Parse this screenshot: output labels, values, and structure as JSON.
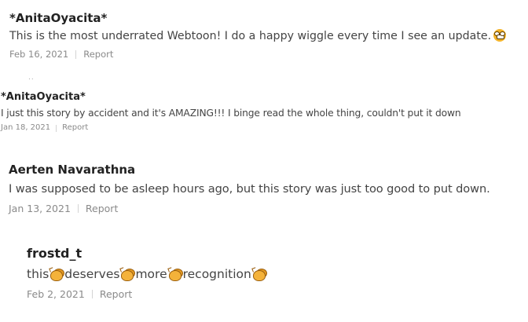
{
  "comments": [
    {
      "author": "*AnitaOyacita*",
      "text": "This is the most underrated Webtoon! I do a happy wiggle every time I see an update.",
      "emoji": "grimacing-face-icon",
      "date": "Feb 16, 2021",
      "report_label": "Report"
    },
    {
      "author": "*AnitaOyacita*",
      "text": "I just this story by accident and it's AMAZING!!! I binge read the whole thing, couldn't put it down",
      "date": "Jan 18, 2021",
      "report_label": "Report"
    },
    {
      "author": "Aerten Navarathna",
      "text": "I was supposed to be asleep hours ago, but this story was just too good to put down.",
      "date": "Jan 13, 2021",
      "report_label": "Report"
    },
    {
      "author": "frostd_t",
      "words": [
        "this",
        "deserves",
        "more",
        "recognition"
      ],
      "emoji": "clapping-hands-icon",
      "date": "Feb 2, 2021",
      "report_label": "Report"
    }
  ],
  "separator_dots": ".."
}
